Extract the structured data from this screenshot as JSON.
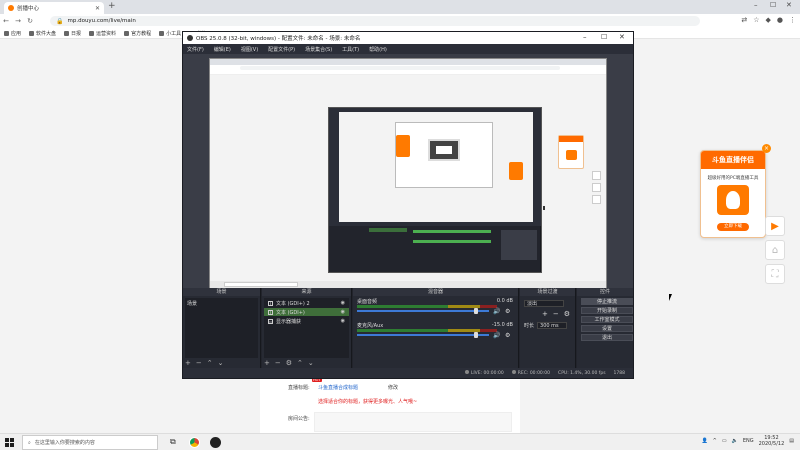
{
  "browser": {
    "tab_title": "创播中心",
    "url": "mp.douyu.com/live/main",
    "bookmarks": [
      "应用",
      "软件大盘",
      "日报",
      "运营资料",
      "官方教程",
      "小工具",
      "书签"
    ]
  },
  "obs": {
    "title": "OBS 25.0.8 (32-bit, windows) - 配置文件: 未命名 - 场景: 未命名",
    "menu": [
      "文件(F)",
      "编辑(E)",
      "视图(V)",
      "配置文件(P)",
      "场景集合(S)",
      "工具(T)",
      "帮助(H)"
    ],
    "docks": {
      "scenes": {
        "title": "场景",
        "items": [
          "场景"
        ]
      },
      "sources": {
        "title": "来源",
        "items": [
          {
            "name": "文本 (GDI+) 2",
            "selected": false
          },
          {
            "name": "文本 (GDI+)",
            "selected": true
          },
          {
            "name": "显示器捕获",
            "selected": false
          }
        ]
      },
      "mixer": {
        "title": "混音器",
        "channels": [
          {
            "name": "桌面音频",
            "db": "0.0 dB",
            "level": 0.9
          },
          {
            "name": "麦克风/Aux",
            "db": "-15.0 dB",
            "level": 0.9
          }
        ]
      },
      "transitions": {
        "title": "场景过渡",
        "type": "淡出",
        "duration_label": "时长",
        "duration": "300 ms"
      },
      "controls": {
        "title": "控件",
        "buttons": [
          "停止推流",
          "开始录制",
          "工作室模式",
          "设置",
          "退出"
        ]
      }
    },
    "status": {
      "live": "LIVE: 00:00:00",
      "rec": "REC: 00:00:00",
      "cpu": "CPU: 1.4%, 30.00 fps",
      "kb": "1788"
    }
  },
  "page": {
    "title_label": "直播标题:",
    "title_value": "斗鱼直播合成标题",
    "hot_badge": "HOT",
    "edit_link": "修改",
    "warning": "选择适合你的标题，获得更多曝光、人气哦~",
    "notice_label": "房间公告:"
  },
  "promo": {
    "header": "斗鱼直播伴侣",
    "subtitle": "超级好用的PC端直播工具",
    "button": "立即下载"
  },
  "taskbar": {
    "search_placeholder": "在这里输入你要搜索的内容",
    "lang": "ENG",
    "time": "19:52",
    "date": "2020/5/12"
  }
}
